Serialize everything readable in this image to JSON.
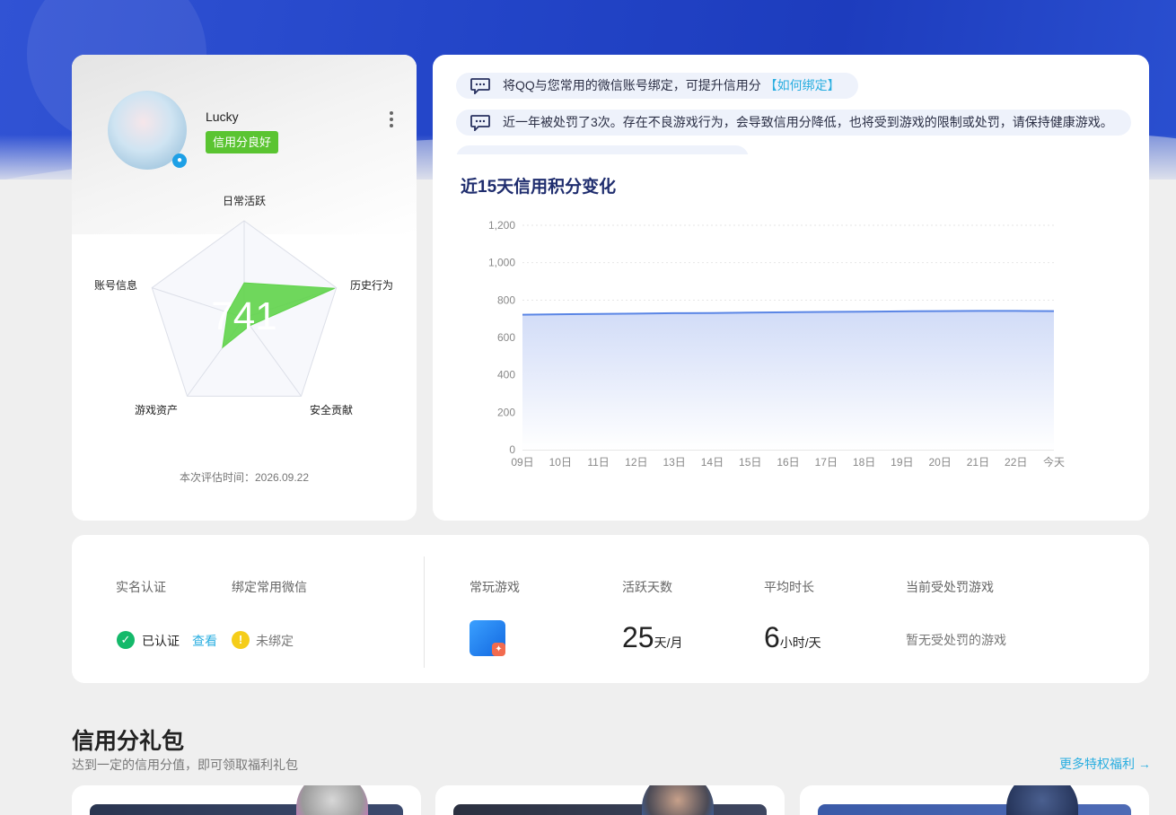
{
  "profile": {
    "username": "Lucky",
    "credit_status": "信用分良好",
    "score": "741",
    "eval_time": "本次评估时间：2026.09.22",
    "radar": {
      "axes": [
        "日常活跃",
        "历史行为",
        "安全贡献",
        "游戏资产",
        "账号信息"
      ],
      "values": [
        0.36,
        0.98,
        0.1,
        0.38,
        0.18
      ]
    }
  },
  "notices": [
    {
      "text": "将QQ与您常用的微信账号绑定，可提升信用分",
      "link": "【如何绑定】"
    },
    {
      "text": "近一年被处罚了3次。存在不良游戏行为，会导致信用分降低，也将受到游戏的限制或处罚，请保持健康游戏。",
      "link": ""
    }
  ],
  "chart_title": "近15天信用积分变化",
  "chart_data": {
    "type": "area",
    "categories": [
      "09日",
      "10日",
      "11日",
      "12日",
      "13日",
      "14日",
      "15日",
      "16日",
      "17日",
      "18日",
      "19日",
      "20日",
      "21日",
      "22日",
      "今天"
    ],
    "series": [
      {
        "values": [
          722,
          724,
          726,
          728,
          730,
          731,
          733,
          735,
          737,
          738,
          740,
          741,
          742,
          742,
          741
        ]
      }
    ],
    "ylim": [
      0,
      1200
    ],
    "yticks": [
      "0",
      "200",
      "400",
      "600",
      "800",
      "1,000",
      "1,200"
    ],
    "grid": true
  },
  "stats": {
    "realname_label": "实名认证",
    "wechat_label": "绑定常用微信",
    "verified": "已认证",
    "view": "查看",
    "unbound": "未绑定",
    "common_games_label": "常玩游戏",
    "active_days_label": "活跃天数",
    "active_days_value": "25",
    "active_days_unit": "天/月",
    "avg_time_label": "平均时长",
    "avg_time_value": "6",
    "avg_time_unit": "小时/天",
    "penalty_label": "当前受处罚游戏",
    "penalty_value": "暂无受处罚的游戏"
  },
  "gifts": {
    "title": "信用分礼包",
    "subtitle": "达到一定的信用分值，即可领取福利礼包",
    "more": "更多特权福利 →"
  }
}
